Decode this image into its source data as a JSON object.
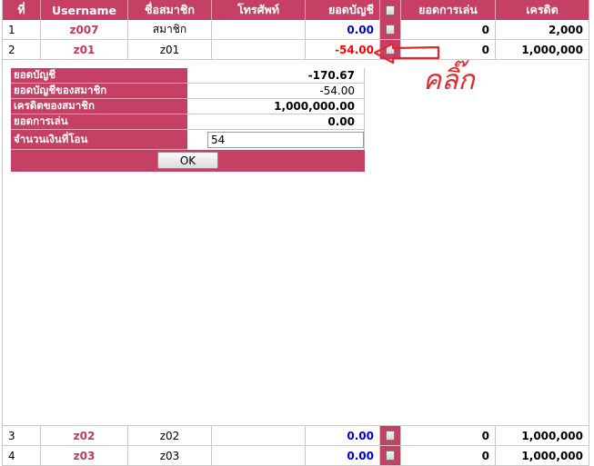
{
  "headers": {
    "no": "ที่",
    "username": "Username",
    "member_name": "ชื่อสมาชิก",
    "phone": "โทรศัพท์",
    "balance": "ยอดบัญชี",
    "play_total": "ยอดการเล่น",
    "credit": "เครดิต"
  },
  "rows": [
    {
      "no": "1",
      "username": "z007",
      "name": "สมาชิก",
      "phone": "",
      "balance": "0.00",
      "play": "0",
      "credit": "2,000"
    },
    {
      "no": "2",
      "username": "z01",
      "name": "z01",
      "phone": "",
      "balance": "-54.00",
      "play": "0",
      "credit": "1,000,000"
    },
    {
      "no": "3",
      "username": "z02",
      "name": "z02",
      "phone": "",
      "balance": "0.00",
      "play": "0",
      "credit": "1,000,000"
    },
    {
      "no": "4",
      "username": "z03",
      "name": "z03",
      "phone": "",
      "balance": "0.00",
      "play": "0",
      "credit": "1,000,000"
    }
  ],
  "popup": {
    "account_balance_label": "ยอดบัญชี",
    "account_balance_value": "-170.67",
    "member_balance_label": "ยอดบัญชีของสมาชิก",
    "member_balance_value": "-54.00",
    "member_credit_label": "เครดิตของสมาชิก",
    "member_credit_value": "1,000,000.00",
    "play_label": "ยอดการเล่น",
    "play_value": "0.00",
    "transfer_label": "จำนวนเงินที่โอน",
    "transfer_value": "54",
    "ok_label": "OK"
  },
  "annotation": {
    "handwritten_text": "คลิ๊ก",
    "color": "#e8242c"
  },
  "colors": {
    "header_bg": "#c63f64",
    "username": "#c23a5e",
    "balance_positive": "#0000cc",
    "balance_negative": "#ff0000"
  }
}
